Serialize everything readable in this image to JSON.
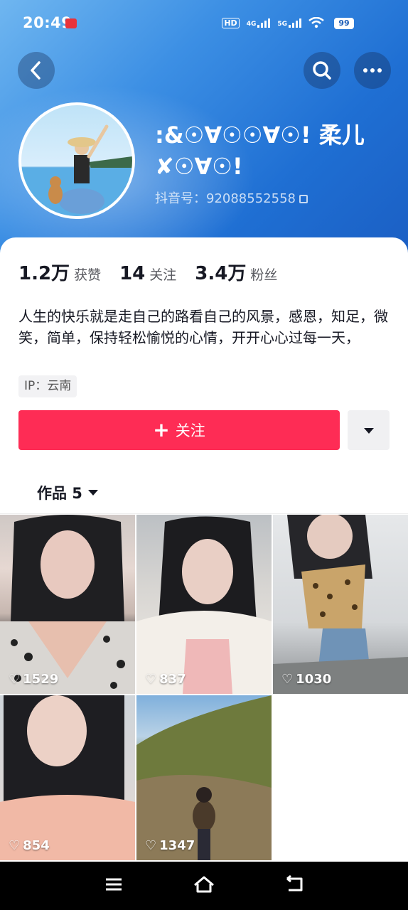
{
  "status_bar": {
    "time": "20:49",
    "network_hd": "HD",
    "network_4g": "4G",
    "network_5g": "5G",
    "battery": "99"
  },
  "profile": {
    "nickname": ":&☉∀☉☉∀☉! 柔儿✘☉∀☉!",
    "douyin_id": "抖音号：92088552558"
  },
  "stats": [
    {
      "value": "1.2万",
      "label": "获赞"
    },
    {
      "value": "14",
      "label": "关注"
    },
    {
      "value": "3.4万",
      "label": "粉丝"
    }
  ],
  "bio": "人生的快乐就是走自己的路看自己的风景，感恩，知足，微笑，简单，保持轻松愉悦的心情，开开心心过每一天，",
  "ip_location": "IP：云南",
  "follow_button": "关注",
  "works_tab": "作品 5",
  "videos": [
    {
      "likes": "1529"
    },
    {
      "likes": "837"
    },
    {
      "likes": "1030"
    },
    {
      "likes": "854"
    },
    {
      "likes": "1347"
    }
  ],
  "colors": {
    "follow": "#fe2c55",
    "header_gradient_start": "#6fb6f0",
    "header_gradient_end": "#1b5fc4"
  }
}
